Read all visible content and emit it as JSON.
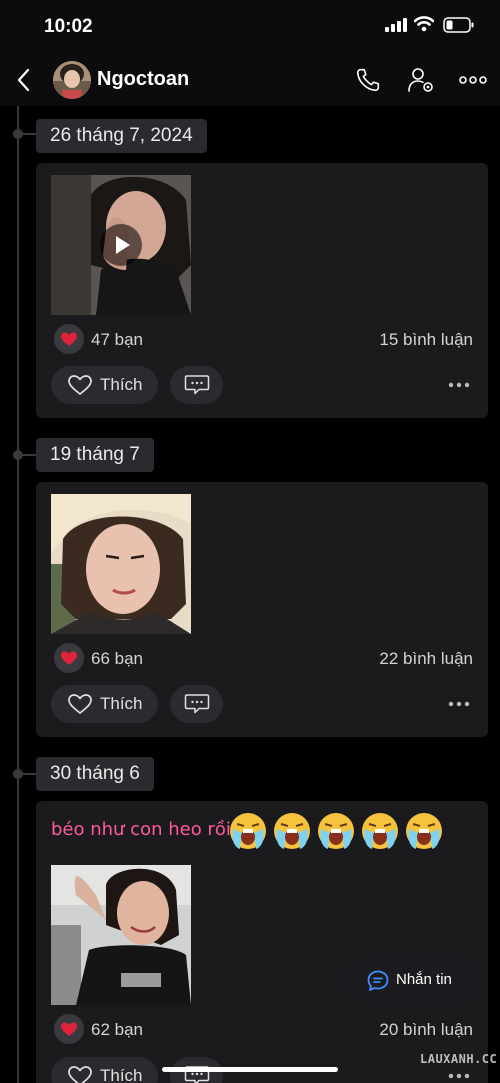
{
  "status_bar": {
    "time": "10:02"
  },
  "header": {
    "name": "Ngoctoan"
  },
  "posts": [
    {
      "date": "26 tháng 7, 2024",
      "media": "video",
      "reactions": "47 bạn",
      "comments": "15 bình luận",
      "like_label": "Thích"
    },
    {
      "date": "19 tháng 7",
      "media": "photo",
      "reactions": "66 bạn",
      "comments": "22 bình luận",
      "like_label": "Thích"
    },
    {
      "date": "30 tháng 6",
      "caption": "béo như con heo rồi",
      "media": "photo",
      "reactions": "62 bạn",
      "comments": "20 bình luận",
      "like_label": "Thích"
    }
  ],
  "message_button": {
    "label": "Nhắn tin"
  },
  "watermark": "LAUXANH.CC",
  "colors": {
    "background": "#000000",
    "card": "#1b1b1e",
    "caption_pink": "#ff5a9a",
    "heart_red": "#e0233c"
  }
}
